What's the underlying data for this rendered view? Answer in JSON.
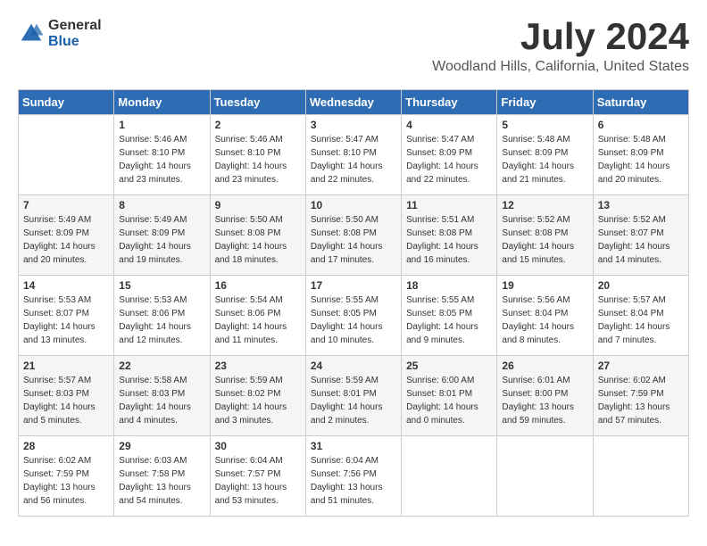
{
  "logo": {
    "general": "General",
    "blue": "Blue"
  },
  "title": "July 2024",
  "location": "Woodland Hills, California, United States",
  "headers": [
    "Sunday",
    "Monday",
    "Tuesday",
    "Wednesday",
    "Thursday",
    "Friday",
    "Saturday"
  ],
  "weeks": [
    [
      {
        "day": "",
        "sunrise": "",
        "sunset": "",
        "daylight": ""
      },
      {
        "day": "1",
        "sunrise": "Sunrise: 5:46 AM",
        "sunset": "Sunset: 8:10 PM",
        "daylight": "Daylight: 14 hours and 23 minutes."
      },
      {
        "day": "2",
        "sunrise": "Sunrise: 5:46 AM",
        "sunset": "Sunset: 8:10 PM",
        "daylight": "Daylight: 14 hours and 23 minutes."
      },
      {
        "day": "3",
        "sunrise": "Sunrise: 5:47 AM",
        "sunset": "Sunset: 8:10 PM",
        "daylight": "Daylight: 14 hours and 22 minutes."
      },
      {
        "day": "4",
        "sunrise": "Sunrise: 5:47 AM",
        "sunset": "Sunset: 8:09 PM",
        "daylight": "Daylight: 14 hours and 22 minutes."
      },
      {
        "day": "5",
        "sunrise": "Sunrise: 5:48 AM",
        "sunset": "Sunset: 8:09 PM",
        "daylight": "Daylight: 14 hours and 21 minutes."
      },
      {
        "day": "6",
        "sunrise": "Sunrise: 5:48 AM",
        "sunset": "Sunset: 8:09 PM",
        "daylight": "Daylight: 14 hours and 20 minutes."
      }
    ],
    [
      {
        "day": "7",
        "sunrise": "Sunrise: 5:49 AM",
        "sunset": "Sunset: 8:09 PM",
        "daylight": "Daylight: 14 hours and 20 minutes."
      },
      {
        "day": "8",
        "sunrise": "Sunrise: 5:49 AM",
        "sunset": "Sunset: 8:09 PM",
        "daylight": "Daylight: 14 hours and 19 minutes."
      },
      {
        "day": "9",
        "sunrise": "Sunrise: 5:50 AM",
        "sunset": "Sunset: 8:08 PM",
        "daylight": "Daylight: 14 hours and 18 minutes."
      },
      {
        "day": "10",
        "sunrise": "Sunrise: 5:50 AM",
        "sunset": "Sunset: 8:08 PM",
        "daylight": "Daylight: 14 hours and 17 minutes."
      },
      {
        "day": "11",
        "sunrise": "Sunrise: 5:51 AM",
        "sunset": "Sunset: 8:08 PM",
        "daylight": "Daylight: 14 hours and 16 minutes."
      },
      {
        "day": "12",
        "sunrise": "Sunrise: 5:52 AM",
        "sunset": "Sunset: 8:08 PM",
        "daylight": "Daylight: 14 hours and 15 minutes."
      },
      {
        "day": "13",
        "sunrise": "Sunrise: 5:52 AM",
        "sunset": "Sunset: 8:07 PM",
        "daylight": "Daylight: 14 hours and 14 minutes."
      }
    ],
    [
      {
        "day": "14",
        "sunrise": "Sunrise: 5:53 AM",
        "sunset": "Sunset: 8:07 PM",
        "daylight": "Daylight: 14 hours and 13 minutes."
      },
      {
        "day": "15",
        "sunrise": "Sunrise: 5:53 AM",
        "sunset": "Sunset: 8:06 PM",
        "daylight": "Daylight: 14 hours and 12 minutes."
      },
      {
        "day": "16",
        "sunrise": "Sunrise: 5:54 AM",
        "sunset": "Sunset: 8:06 PM",
        "daylight": "Daylight: 14 hours and 11 minutes."
      },
      {
        "day": "17",
        "sunrise": "Sunrise: 5:55 AM",
        "sunset": "Sunset: 8:05 PM",
        "daylight": "Daylight: 14 hours and 10 minutes."
      },
      {
        "day": "18",
        "sunrise": "Sunrise: 5:55 AM",
        "sunset": "Sunset: 8:05 PM",
        "daylight": "Daylight: 14 hours and 9 minutes."
      },
      {
        "day": "19",
        "sunrise": "Sunrise: 5:56 AM",
        "sunset": "Sunset: 8:04 PM",
        "daylight": "Daylight: 14 hours and 8 minutes."
      },
      {
        "day": "20",
        "sunrise": "Sunrise: 5:57 AM",
        "sunset": "Sunset: 8:04 PM",
        "daylight": "Daylight: 14 hours and 7 minutes."
      }
    ],
    [
      {
        "day": "21",
        "sunrise": "Sunrise: 5:57 AM",
        "sunset": "Sunset: 8:03 PM",
        "daylight": "Daylight: 14 hours and 5 minutes."
      },
      {
        "day": "22",
        "sunrise": "Sunrise: 5:58 AM",
        "sunset": "Sunset: 8:03 PM",
        "daylight": "Daylight: 14 hours and 4 minutes."
      },
      {
        "day": "23",
        "sunrise": "Sunrise: 5:59 AM",
        "sunset": "Sunset: 8:02 PM",
        "daylight": "Daylight: 14 hours and 3 minutes."
      },
      {
        "day": "24",
        "sunrise": "Sunrise: 5:59 AM",
        "sunset": "Sunset: 8:01 PM",
        "daylight": "Daylight: 14 hours and 2 minutes."
      },
      {
        "day": "25",
        "sunrise": "Sunrise: 6:00 AM",
        "sunset": "Sunset: 8:01 PM",
        "daylight": "Daylight: 14 hours and 0 minutes."
      },
      {
        "day": "26",
        "sunrise": "Sunrise: 6:01 AM",
        "sunset": "Sunset: 8:00 PM",
        "daylight": "Daylight: 13 hours and 59 minutes."
      },
      {
        "day": "27",
        "sunrise": "Sunrise: 6:02 AM",
        "sunset": "Sunset: 7:59 PM",
        "daylight": "Daylight: 13 hours and 57 minutes."
      }
    ],
    [
      {
        "day": "28",
        "sunrise": "Sunrise: 6:02 AM",
        "sunset": "Sunset: 7:59 PM",
        "daylight": "Daylight: 13 hours and 56 minutes."
      },
      {
        "day": "29",
        "sunrise": "Sunrise: 6:03 AM",
        "sunset": "Sunset: 7:58 PM",
        "daylight": "Daylight: 13 hours and 54 minutes."
      },
      {
        "day": "30",
        "sunrise": "Sunrise: 6:04 AM",
        "sunset": "Sunset: 7:57 PM",
        "daylight": "Daylight: 13 hours and 53 minutes."
      },
      {
        "day": "31",
        "sunrise": "Sunrise: 6:04 AM",
        "sunset": "Sunset: 7:56 PM",
        "daylight": "Daylight: 13 hours and 51 minutes."
      },
      {
        "day": "",
        "sunrise": "",
        "sunset": "",
        "daylight": ""
      },
      {
        "day": "",
        "sunrise": "",
        "sunset": "",
        "daylight": ""
      },
      {
        "day": "",
        "sunrise": "",
        "sunset": "",
        "daylight": ""
      }
    ]
  ]
}
